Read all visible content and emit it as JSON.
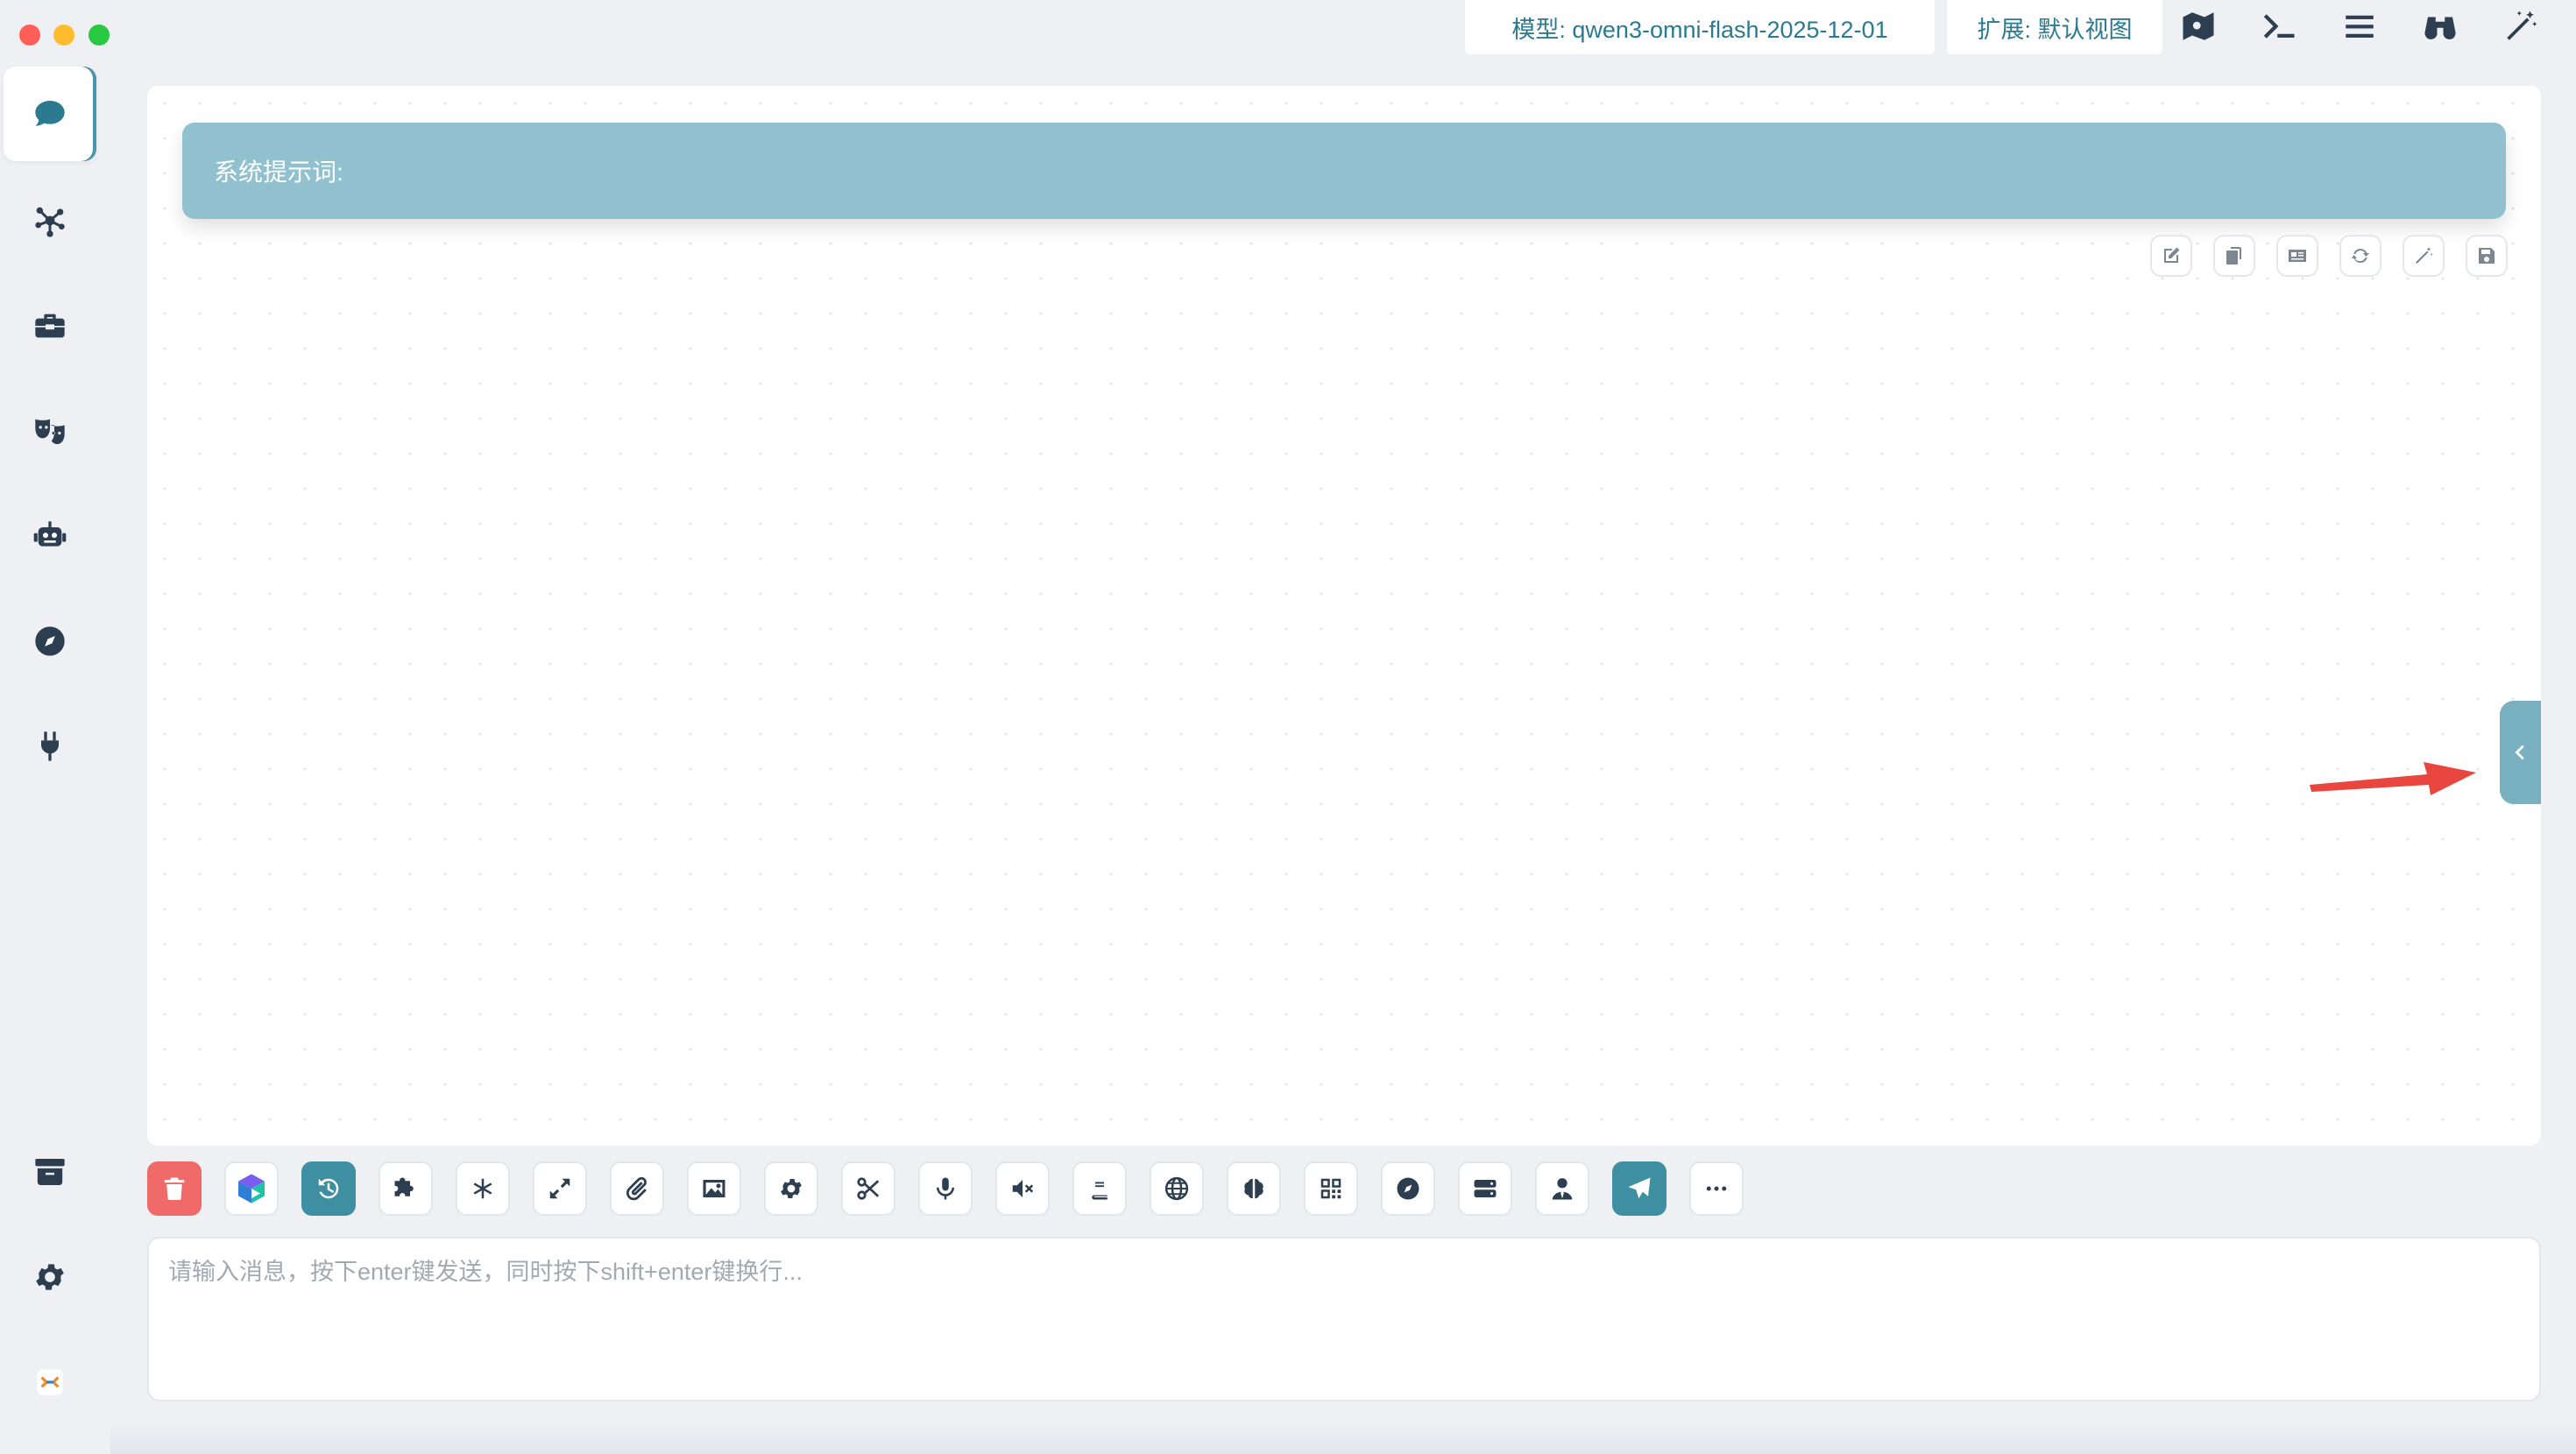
{
  "window": {
    "controls": [
      "close",
      "minimize",
      "maximize"
    ]
  },
  "topbar": {
    "model_label": "模型: qwen3-omni-flash-2025-12-01",
    "extension_label": "扩展: 默认视图",
    "icons": [
      "map-icon",
      "terminal-icon",
      "menu-icon",
      "binoculars-icon",
      "magic-wand-icon"
    ]
  },
  "sidebar": {
    "items": [
      "chat-icon",
      "network-icon",
      "toolbox-icon",
      "masks-icon",
      "robot-icon",
      "compass-icon",
      "plug-icon"
    ],
    "bottom_items": [
      "archive-icon",
      "settings-icon",
      "app-logo"
    ],
    "active": "chat-icon"
  },
  "chat": {
    "system_prompt_label": "系统提示词:",
    "message_tools": [
      "edit-icon",
      "copy-icon",
      "id-card-icon",
      "refresh-icon",
      "magic-wand-icon",
      "save-icon"
    ]
  },
  "toolbar": {
    "buttons": [
      "trash-icon",
      "brand-logo-icon",
      "history-icon",
      "puzzle-icon",
      "asterisk-icon",
      "expand-icon",
      "paperclip-icon",
      "image-icon",
      "gear-icon",
      "scissors-icon",
      "microphone-icon",
      "mute-icon",
      "book-icon",
      "globe-icon",
      "brain-icon",
      "qrcode-icon",
      "compass-icon",
      "server-icon",
      "user-tie-icon",
      "send-icon",
      "more-icon"
    ]
  },
  "input": {
    "placeholder": "请输入消息，按下enter键发送，同时按下shift+enter键换行..."
  },
  "colors": {
    "accent": "#3f8fa3",
    "system_bar": "#91c1cf",
    "danger": "#f06a6a",
    "arrow": "#e8463e"
  }
}
